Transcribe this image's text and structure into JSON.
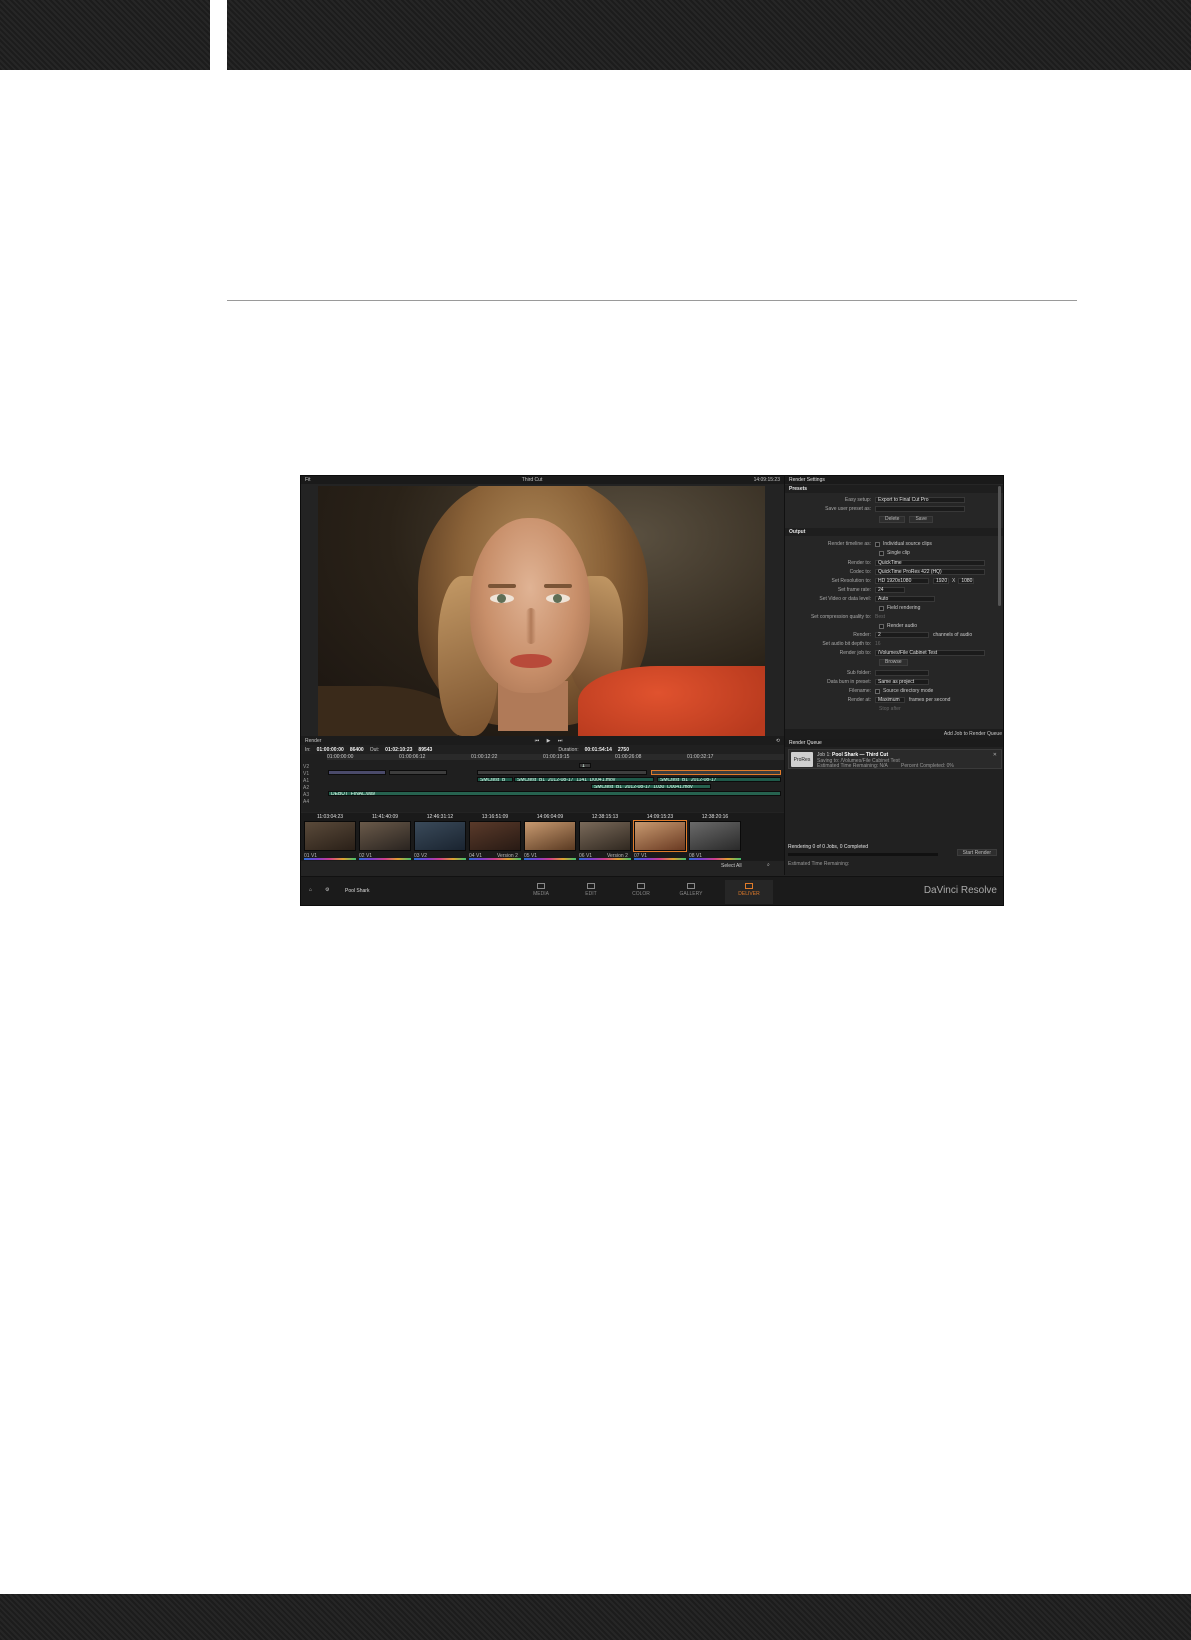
{
  "topbar": {
    "menu": "Fit",
    "clip_name": "Third Cut",
    "timecode": "14:09:15:23"
  },
  "settings": {
    "title": "Render Settings",
    "presets_header": "Presets",
    "easy_setup_label": "Easy setup:",
    "easy_setup_value": "Export to Final Cut Pro",
    "save_preset_label": "Save user preset as:",
    "delete_label": "Delete",
    "save_label": "Save",
    "output_header": "Output",
    "render_timeline_label": "Render timeline as:",
    "individual_clips": "Individual source clips",
    "single_clip": "Single clip",
    "render_to_label": "Render to:",
    "render_to_value": "QuickTime",
    "codec_label": "Codec to:",
    "codec_value": "QuickTime ProRes 422 (HQ)",
    "resolution_label": "Set Resolution to:",
    "resolution_value": "HD 1920x1080",
    "res_w": "1920",
    "res_x": "X",
    "res_h": "1080",
    "frame_rate_label": "Set frame rate:",
    "frame_rate_value": "24",
    "data_levels_label": "Set Video or data level:",
    "data_levels_value": "Auto",
    "field_rendering": "Field rendering",
    "compression_label": "Set compression quality to:",
    "compression_value": "Best",
    "render_audio": "Render audio",
    "render_label": "Render:",
    "render_value": "2",
    "channels_of_audio": "channels of audio",
    "bit_depth_label": "Set audio bit depth to:",
    "bit_depth_value": "16",
    "render_job_label": "Render job to:",
    "render_job_value": "/Volumes/File Cabinet Test",
    "browse_label": "Browse",
    "subfolder_label": "Sub folder:",
    "data_burn_label": "Data burn in preset:",
    "data_burn_value": "Same as project",
    "filename_label": "Filename:",
    "filename_value": "Source directory mode",
    "render_at_label": "Render at:",
    "render_at_value": "Maximum",
    "frames_per_second": "frames per second",
    "stop_after": "Stop after",
    "add_to_queue": "Add Job to Render Queue"
  },
  "transport": {
    "mode": "Render"
  },
  "timecodes": {
    "in_label": "In:",
    "in_value": "01:00:00:00",
    "in_frames": "86400",
    "out_label": "Out:",
    "out_value": "01:02:10:23",
    "out_frames": "89543",
    "duration_label": "Duration:",
    "duration_value": "00:01:54:14",
    "duration_frames": "2750"
  },
  "timeline": {
    "ruler": [
      "01:00:00:00",
      "01:00:06:12",
      "01:00:12:22",
      "01:00:19:15",
      "01:00:26:08",
      "01:00:32:17"
    ],
    "tracks": [
      "V2",
      "V1",
      "A1",
      "A2",
      "A3",
      "A4"
    ],
    "clip_v2": "1",
    "clip_a1a": "SMCtest_B",
    "clip_a1b": "SMCtest_B1_2012-08-17_1141_D0041.mov",
    "clip_a1c": "SMCtest_B1_2012-08-17",
    "clip_a2": "SMCtest_B1_2012-08-17_1141_D0041.mov",
    "clip_music": "SMCtest_B1_2012-08-17_1030_D0041.mov",
    "clip_sound": "DEBUT_FINAL.wav"
  },
  "thumbs": [
    {
      "tc": "11:03:04:23",
      "name": "01  V1"
    },
    {
      "tc": "11:41:40:09",
      "name": "02  V1"
    },
    {
      "tc": "12:46:31:12",
      "name": "03  V2"
    },
    {
      "tc": "13:16:51:09",
      "name": "04  V1"
    },
    {
      "tc": "14:06:04:09",
      "name": "05  V1"
    },
    {
      "tc": "12:38:15:13",
      "name": "06  V1"
    },
    {
      "tc": "14:09:15:23",
      "name": "07  V1"
    },
    {
      "tc": "12:38:20:16",
      "name": "08  V1"
    }
  ],
  "thumb_version": "Version 2",
  "queue": {
    "title": "Render Queue",
    "job_title": "Job 1:",
    "job_name": "Pool Shark — Third Cut",
    "job_icon": "ProRes",
    "saving_to": "Saving to: /Volumes/File Cabinet Test",
    "est_remaining": "Estimated Time Remaining: N/A",
    "completed": "Percent Completed: 0%",
    "status": "Rendering 0 of 0 Jobs, 0 Completed",
    "start_button": "Start Render",
    "time_remaining": "Estimated Time Remaining:",
    "select_all": "Select All"
  },
  "nav": {
    "project": "Pool Shark",
    "items": [
      "MEDIA",
      "EDIT",
      "COLOR",
      "GALLERY",
      "DELIVER"
    ],
    "brand": "DaVinci Resolve"
  }
}
